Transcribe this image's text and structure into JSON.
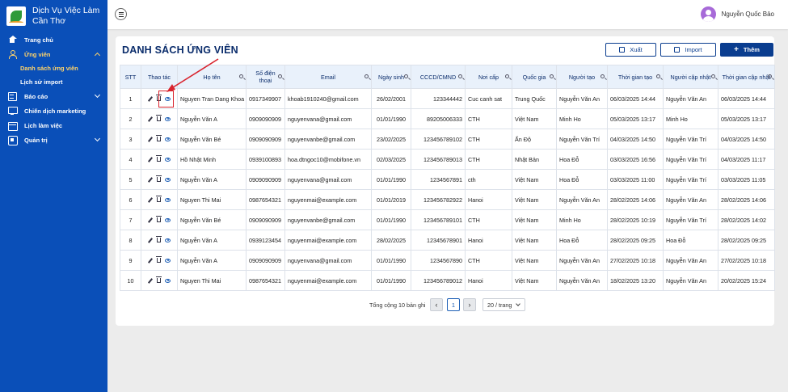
{
  "brand": {
    "line1": "Dịch Vụ Việc Làm",
    "line2": "Cần Thơ"
  },
  "sidebar": {
    "items": [
      {
        "label": "Trang chủ",
        "icon": "home-icon"
      },
      {
        "label": "Ứng viên",
        "icon": "user-icon"
      },
      {
        "label": "Báo cáo",
        "icon": "report-icon"
      },
      {
        "label": "Chiến dịch marketing",
        "icon": "marketing-icon"
      },
      {
        "label": "Lịch làm việc",
        "icon": "calendar-icon"
      },
      {
        "label": "Quản trị",
        "icon": "admin-icon"
      }
    ],
    "ung_vien_sub": [
      {
        "label": "Danh sách ứng viên"
      },
      {
        "label": "Lịch sử import"
      }
    ],
    "active_color": "#ffd36a",
    "bg_color": "#0a4fb8"
  },
  "header": {
    "user_name": "Nguyễn Quốc Bảo"
  },
  "page": {
    "title": "DANH SÁCH ỨNG VIÊN",
    "export_label": "Xuất",
    "import_label": "Import",
    "add_label": "Thêm"
  },
  "table": {
    "columns": [
      "STT",
      "Thao tác",
      "Họ tên",
      "Số điện thoại",
      "Email",
      "Ngày sinh",
      "CCCD/CMND",
      "Nơi cấp",
      "Quốc gia",
      "Người tạo",
      "Thời gian tạo",
      "Người cập nhật",
      "Thời gian cập nhật"
    ],
    "rows": [
      [
        "1",
        "Nguyen Tran Dang Khoa",
        "0917349907",
        "khoab1910240@gmail.com",
        "26/02/2001",
        "123344442",
        "Cuc canh sat",
        "Trung Quốc",
        "Nguyễn Văn An",
        "06/03/2025 14:44",
        "Nguyễn Văn An",
        "06/03/2025 14:44"
      ],
      [
        "2",
        "Nguyễn Văn A",
        "0909090909",
        "nguyenvana@gmail.com",
        "01/01/1990",
        "89205006333",
        "CTH",
        "Việt Nam",
        "Minh Ho",
        "05/03/2025 13:17",
        "Minh Ho",
        "05/03/2025 13:17"
      ],
      [
        "3",
        "Nguyễn Văn Bé",
        "0909090909",
        "nguyenvanbe@gmail.com",
        "23/02/2025",
        "123456789102",
        "CTH",
        "Ấn Độ",
        "Nguyễn Văn Trí",
        "04/03/2025 14:50",
        "Nguyễn Văn Trí",
        "04/03/2025 14:50"
      ],
      [
        "4",
        "Hồ Nhật Minh",
        "0939100893",
        "hoa.dtngoc10@mobifone.vn",
        "02/03/2025",
        "123456789013",
        "CTH",
        "Nhật Bản",
        "Hoa Đỗ",
        "03/03/2025 16:56",
        "Nguyễn Văn Trí",
        "04/03/2025 11:17"
      ],
      [
        "5",
        "Nguyễn Văn A",
        "0909090909",
        "nguyenvana@gmail.com",
        "01/01/1990",
        "1234567891",
        "cth",
        "Việt Nam",
        "Hoa Đỗ",
        "03/03/2025 11:00",
        "Nguyễn Văn Trí",
        "03/03/2025 11:05"
      ],
      [
        "6",
        "Nguyen Thi Mai",
        "0987654321",
        "nguyenmai@example.com",
        "01/01/2019",
        "123456782922",
        "Hanoi",
        "Việt Nam",
        "Nguyễn Văn An",
        "28/02/2025 14:06",
        "Nguyễn Văn An",
        "28/02/2025 14:06"
      ],
      [
        "7",
        "Nguyễn Văn Bé",
        "0909090909",
        "nguyenvanbe@gmail.com",
        "01/01/1990",
        "123456789101",
        "CTH",
        "Việt Nam",
        "Minh Ho",
        "28/02/2025 10:19",
        "Nguyễn Văn Trí",
        "28/02/2025 14:02"
      ],
      [
        "8",
        "Nguyễn Văn A",
        "0939123454",
        "nguyenmai@example.com",
        "28/02/2025",
        "12345678901",
        "Hanoi",
        "Việt Nam",
        "Hoa Đỗ",
        "28/02/2025 09:25",
        "Hoa Đỗ",
        "28/02/2025 09:25"
      ],
      [
        "9",
        "Nguyễn Văn A",
        "0909090909",
        "nguyenvana@gmail.com",
        "01/01/1990",
        "1234567890",
        "CTH",
        "Việt Nam",
        "Nguyễn Văn An",
        "27/02/2025 10:18",
        "Nguyễn Văn An",
        "27/02/2025 10:18"
      ],
      [
        "10",
        "Nguyen Thi Mai",
        "0987654321",
        "nguyenmai@example.com",
        "01/01/1990",
        "123456789012",
        "Hanoi",
        "Việt Nam",
        "Nguyễn Văn An",
        "18/02/2025 13:20",
        "Nguyễn Văn An",
        "20/02/2025 15:24"
      ]
    ]
  },
  "pagination": {
    "total_text": "Tổng cộng 10 bản ghi",
    "prev": "‹",
    "next": "›",
    "current_page": "1",
    "page_size": "20 / trang"
  },
  "annotation": {
    "color": "#d9232d"
  }
}
